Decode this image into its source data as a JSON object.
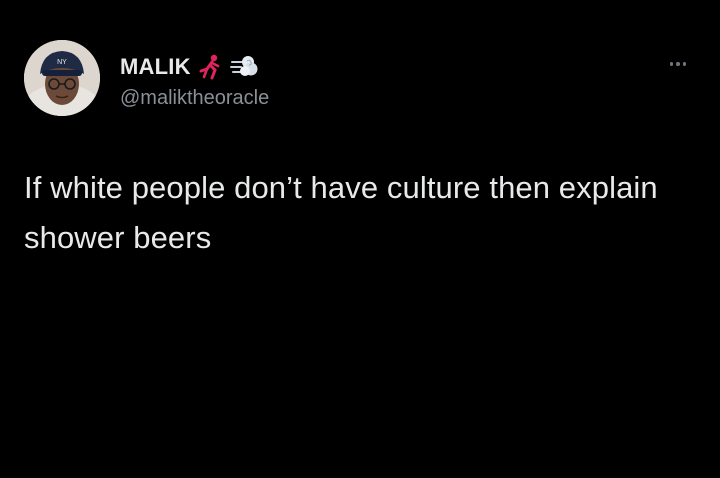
{
  "author": {
    "display_name": "MALIK",
    "handle": "@maliktheoracle",
    "name_emojis": [
      "runner-emoji",
      "dash-emoji"
    ]
  },
  "tweet": {
    "text": "If white people don’t have culture then explain shower beers"
  },
  "icons": {
    "more": "more-horizontal-icon"
  },
  "colors": {
    "background": "#000000",
    "text": "#e7e9ea",
    "secondary": "#8b9096",
    "runner_emoji": "#e0245e"
  }
}
